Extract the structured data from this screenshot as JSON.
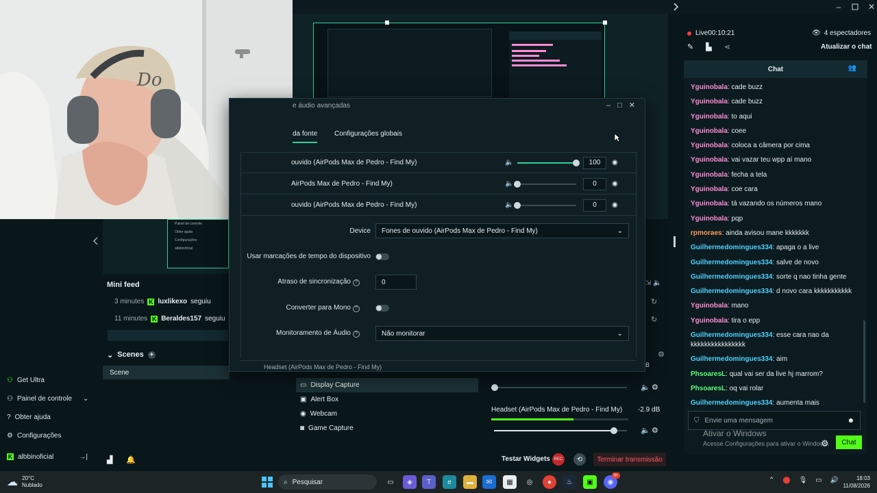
{
  "live": {
    "status": "Live",
    "timer": "00:10:21",
    "viewers": "4 espectadores",
    "refresh_chat": "Atualizar o chat"
  },
  "dialog": {
    "title": "e áudio avançadas",
    "tabs": [
      "da fonte",
      "Configurações globais"
    ],
    "devices": [
      {
        "name": "ouvido (AirPods Max de Pedro - Find My)",
        "volume": "100",
        "level": 1.0
      },
      {
        "name": "AirPods Max de Pedro - Find My)",
        "volume": "0",
        "level": 0.0
      },
      {
        "name": "ouvido (AirPods Max de Pedro - Find My)",
        "volume": "0",
        "level": 0.0
      }
    ],
    "device_label": "Device",
    "device_value": "Fones de ouvido (AirPods Max de Pedro - Find My)",
    "timestamps_label": "Usar marcações de tempo do dispositivo",
    "sync_label": "Atraso de sincronização",
    "sync_value": "0",
    "mono_label": "Converter para Mono",
    "monitor_label": "Monitoramento de Áudio",
    "monitor_value": "Não monitorar",
    "partial_row": "Headset (AirPods Max de Pedro - Find My)"
  },
  "mini_feed": {
    "title": "Mini feed",
    "items": [
      {
        "time": "3 minutes",
        "user": "luxlikexo",
        "action": "seguiu"
      },
      {
        "time": "11 minutes",
        "user": "Beraldes157",
        "action": "seguiu"
      }
    ]
  },
  "nav": {
    "items": [
      "Get Ultra",
      "Painel de controle",
      "Obter ajuda",
      "Configurações"
    ],
    "user": "albbinoficial"
  },
  "scenes": {
    "title": "Scenes",
    "items": [
      "Scene"
    ]
  },
  "sources": {
    "items": [
      "Display Capture",
      "Alert Box",
      "Webcam",
      "Game Capture"
    ]
  },
  "mixer": {
    "top_value": "dB",
    "device": "Headset (AirPods Max de Pedro - Find My)",
    "db": "-2.9 dB",
    "level": 0.9
  },
  "bottom": {
    "test_widgets": "Testar Widgets",
    "rec": "REC",
    "end_stream": "Terminar transmissão"
  },
  "chat": {
    "title": "Chat",
    "messages": [
      {
        "user": "Yguinobala",
        "text": "cade buzz",
        "color": "#ff8bd6"
      },
      {
        "user": "Yguinobala",
        "text": "cade buzz",
        "color": "#ff8bd6"
      },
      {
        "user": "Yguinobala",
        "text": "to aqui",
        "color": "#ff8bd6"
      },
      {
        "user": "Yguinobala",
        "text": "coee",
        "color": "#ff8bd6"
      },
      {
        "user": "Yguinobala",
        "text": "coloca a câmera por cima",
        "color": "#ff8bd6"
      },
      {
        "user": "Yguinobala",
        "text": "vai vazar teu wpp aí mano",
        "color": "#ff8bd6"
      },
      {
        "user": "Yguinobala",
        "text": "fecha a tela",
        "color": "#ff8bd6"
      },
      {
        "user": "Yguinobala",
        "text": "coe cara",
        "color": "#ff8bd6"
      },
      {
        "user": "Yguinobala",
        "text": "tá vazando os números mano",
        "color": "#ff8bd6"
      },
      {
        "user": "Yguinobala",
        "text": "pqp",
        "color": "#ff8bd6"
      },
      {
        "user": "rpmoraes",
        "text": "ainda avisou mane kkkkkkk",
        "color": "#ff9b54"
      },
      {
        "user": "Guilhermedomingues334",
        "text": "apaga o a live",
        "color": "#4fd1ff"
      },
      {
        "user": "Guilhermedomingues334",
        "text": "salve de novo",
        "color": "#4fd1ff"
      },
      {
        "user": "Guilhermedomingues334",
        "text": "sorte q nao tinha gente",
        "color": "#4fd1ff"
      },
      {
        "user": "Guilhermedomingues334",
        "text": "d novo cara kkkkkkkkkkk",
        "color": "#4fd1ff"
      },
      {
        "user": "Yguinobala",
        "text": "mano",
        "color": "#ff8bd6"
      },
      {
        "user": "Yguinobala",
        "text": "tira o epp",
        "color": "#ff8bd6"
      },
      {
        "user": "Guilhermedomingues334",
        "text": "esse cara nao da kkkkkkkkkkkkkkkk",
        "color": "#4fd1ff"
      },
      {
        "user": "Guilhermedomingues334",
        "text": "aim",
        "color": "#4fd1ff"
      },
      {
        "user": "PhsoaresL",
        "text": "qual vai ser da live hj marrom?",
        "color": "#5dff7a"
      },
      {
        "user": "PhsoaresL",
        "text": "oq vai rolar",
        "color": "#5dff7a"
      },
      {
        "user": "Guilhermedomingues334",
        "text": "aumenta mais",
        "color": "#4fd1ff"
      }
    ],
    "input_placeholder": "Envie uma mensagem",
    "send_button": "Chat",
    "activate_title": "Ativar o Windows",
    "activate_sub": "Acesse Configurações para ativar o Windows."
  },
  "taskbar": {
    "weather_temp": "20°C",
    "weather_desc": "Nublado",
    "search_placeholder": "Pesquisar",
    "time": "18:03",
    "date": "11/08/2026",
    "discord_badge": "9+"
  }
}
